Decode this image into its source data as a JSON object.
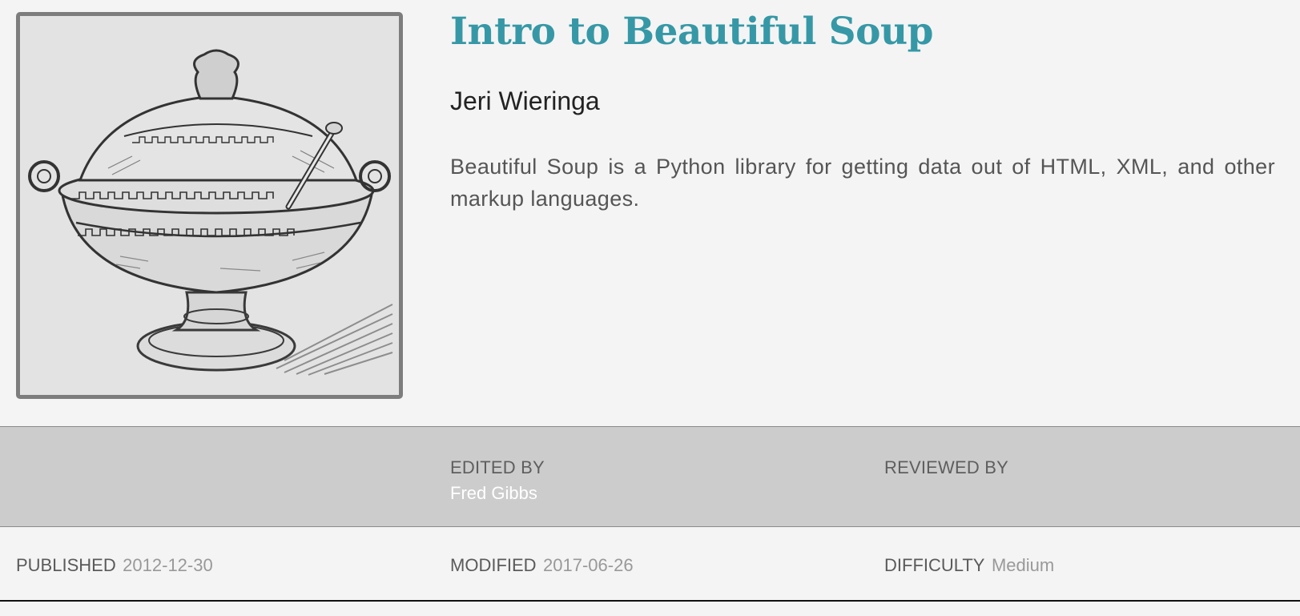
{
  "lesson": {
    "title": "Intro to Beautiful Soup",
    "author": "Jeri Wieringa",
    "abstract": "Beautiful Soup is a Python library for getting data out of HTML, XML, and other markup languages.",
    "cover_image": "soup-tureen-engraving"
  },
  "credits": {
    "edited_by_label": "EDITED BY",
    "editor": "Fred Gibbs",
    "reviewed_by_label": "REVIEWED BY"
  },
  "meta": {
    "published_label": "PUBLISHED",
    "published_date": "2012-12-30",
    "modified_label": "MODIFIED",
    "modified_date": "2017-06-26",
    "difficulty_label": "DIFFICULTY",
    "difficulty_value": "Medium"
  },
  "colors": {
    "title": "#3698a6",
    "background": "#f4f4f4",
    "credits_band": "#cccccc"
  }
}
